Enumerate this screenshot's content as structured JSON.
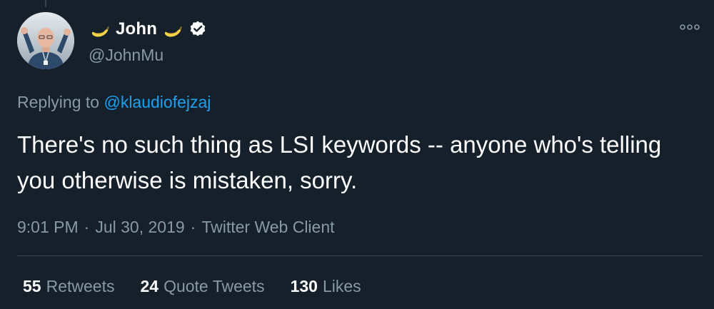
{
  "author": {
    "name": "John",
    "handle": "@JohnMu",
    "name_emoji": "banana-icon",
    "verified": true
  },
  "reply": {
    "prefix": "Replying to",
    "mention": "@klaudiofejzaj"
  },
  "tweet": {
    "text": "There's no such thing as LSI keywords -- anyone who's telling you otherwise is mistaken, sorry."
  },
  "meta": {
    "time": "9:01 PM",
    "separator": "·",
    "date": "Jul 30, 2019",
    "client": "Twitter Web Client"
  },
  "stats": {
    "retweets_count": "55",
    "retweets_label": "Retweets",
    "quotes_count": "24",
    "quotes_label": "Quote Tweets",
    "likes_count": "130",
    "likes_label": "Likes"
  },
  "colors": {
    "background": "#15202b",
    "text_primary": "#ffffff",
    "text_secondary": "#8899a6",
    "link": "#1da1f2",
    "divider": "#38444d"
  }
}
